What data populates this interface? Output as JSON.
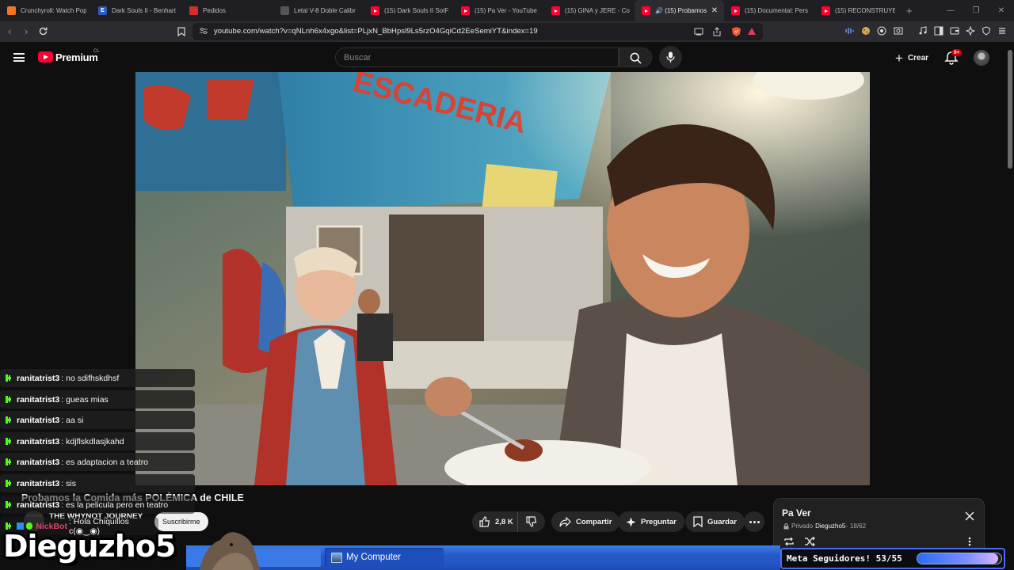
{
  "browser": {
    "tabs": [
      {
        "title": "Crunchyroll: Watch Pop",
        "favicon": "crunchyroll-icon",
        "active": false
      },
      {
        "title": "Dark Souls II - Benhart",
        "favicon": "e-icon",
        "active": false
      },
      {
        "title": "Pedidos",
        "favicon": "mail-icon",
        "active": false
      },
      {
        "title": "Letal V-8 Doble Calibr",
        "favicon": "page-icon",
        "active": false
      },
      {
        "title": "(15) Dark Souls II SotFS",
        "favicon": "youtube-icon",
        "active": false
      },
      {
        "title": "(15) Pa Ver - YouTube",
        "favicon": "youtube-icon",
        "active": false
      },
      {
        "title": "(15) GINA y JERE - Corr",
        "favicon": "youtube-icon",
        "active": false
      },
      {
        "title": "(15) Probamos",
        "favicon": "youtube-icon",
        "active": true
      },
      {
        "title": "(15) Documental: Pers",
        "favicon": "youtube-icon",
        "active": false
      },
      {
        "title": "(15) RECONSTRUYENDO",
        "favicon": "youtube-icon",
        "active": false
      }
    ],
    "url": "youtube.com/watch?v=qNLnh6x4xgo&list=PLjxN_BbHpsl9Ls5rzO4GqiCd2EeSemiYT&index=19"
  },
  "youtube": {
    "brand": "Premium",
    "country": "CL",
    "search_placeholder": "Buscar",
    "create_label": "Crear",
    "notifications_badge": "9+",
    "video_title": "Probamos la Comida más POLÉMICA de CHILE",
    "channel_name": "THE WHYNOT JOURNEY",
    "subscribe_label": "Suscribirme",
    "likes": "2,8 K",
    "share_label": "Compartir",
    "ask_label": "Preguntar",
    "save_label": "Guardar"
  },
  "playlist": {
    "title": "Pa Ver",
    "privacy": "Privado",
    "owner": "Dieguzho5",
    "position": "18/62"
  },
  "stream_overlay": {
    "chat": [
      {
        "user": "ranitatrist3",
        "message": ": no sdifhskdhsf"
      },
      {
        "user": "ranitatrist3",
        "message": ": gueas mias"
      },
      {
        "user": "ranitatrist3",
        "message": ": aa si"
      },
      {
        "user": "ranitatrist3",
        "message": ": kdjflskdlasjkahd"
      },
      {
        "user": "ranitatrist3",
        "message": ": es adaptacion a teatro"
      },
      {
        "user": "ranitatrist3",
        "message": ": sis"
      },
      {
        "user": "ranitatrist3",
        "message": ": es la pelicula pero en teatro"
      },
      {
        "user": "NickBot",
        "message": ": Hola Chiquillos c(◉‿◉)"
      }
    ],
    "streamer_name": "Dieguzho5",
    "taskbar_item": "My Computer",
    "goal_label": "Meta Seguidores! 53/55",
    "goal_progress": 0.9636
  },
  "colors": {
    "youtube_red": "#ff0033",
    "kick_green": "#53fc18",
    "xp_taskbar_blue": "#2457c6",
    "goal_border": "#4a6df0"
  }
}
